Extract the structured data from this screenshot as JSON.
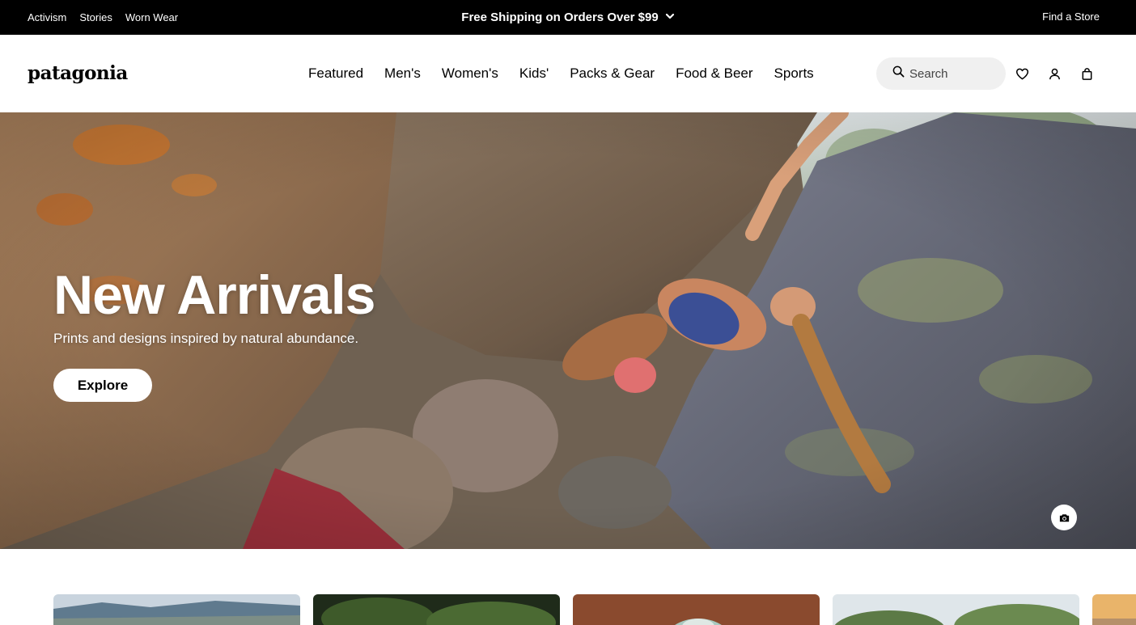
{
  "topbar": {
    "links": [
      "Activism",
      "Stories",
      "Worn Wear"
    ],
    "promo": "Free Shipping on Orders Over $99",
    "find_store": "Find a Store"
  },
  "header": {
    "logo": "patagonia",
    "nav": [
      "Featured",
      "Men's",
      "Women's",
      "Kids'",
      "Packs & Gear",
      "Food & Beer",
      "Sports"
    ],
    "search_placeholder": "Search"
  },
  "hero": {
    "title": "New Arrivals",
    "subtitle": "Prints and designs inspired by natural abundance.",
    "button": "Explore"
  },
  "icons": {
    "promo_toggle": "chevron-down-icon",
    "search": "search-icon",
    "wishlist": "heart-icon",
    "account": "user-icon",
    "cart": "bag-icon",
    "photo_credit": "camera-icon"
  }
}
